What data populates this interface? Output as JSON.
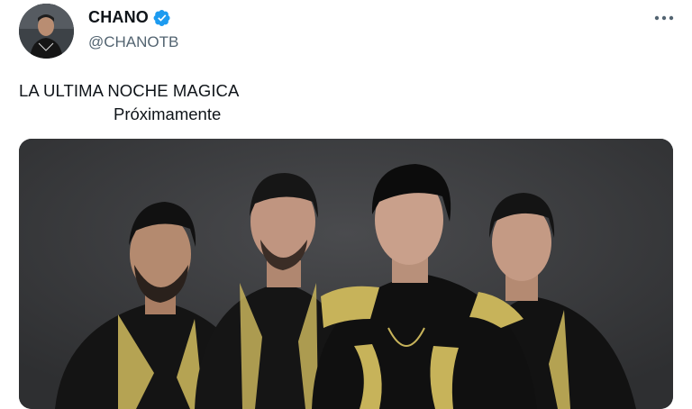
{
  "author": {
    "display_name": "CHANO",
    "handle": "@CHANOTB",
    "verified": true
  },
  "tweet": {
    "line1": "LA ULTIMA NOCHE MAGICA",
    "line2": "Próximamente"
  },
  "icons": {
    "more": "more-horizontal-icon",
    "verified": "verified-badge-icon"
  },
  "colors": {
    "verified_blue": "#1d9bf0",
    "handle_gray": "#536471",
    "text": "#0f1419",
    "photo_bg": "#3a3b3d",
    "jacket_gold": "#c7b35a"
  }
}
